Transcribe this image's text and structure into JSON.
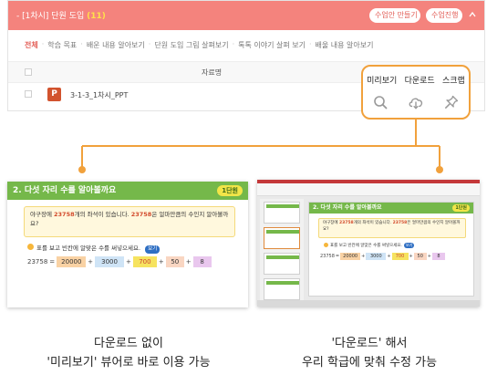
{
  "header": {
    "lesson": "- [1차시] 단원 도입",
    "count": "(11)",
    "btn_make": "수업안 만들기",
    "btn_progress": "수업진행"
  },
  "tabs": [
    "전체",
    "학습 목표",
    "배운 내용 알아보기",
    "단원 도입 그림 살펴보기",
    "톡톡 이야기 살펴 보기",
    "배울 내용 알아보기"
  ],
  "table": {
    "column_label": "자료명",
    "row_badge": "P",
    "row_file": "3-1-3_1차시_PPT"
  },
  "actions": {
    "preview": "미리보기",
    "download": "다운로드",
    "scrap": "스크랩",
    "colors": {
      "highlight": "#f1a13c",
      "header": "#f4837d"
    }
  },
  "slide": {
    "title": "2. 다섯 자리 수를 알아볼까요",
    "badge": "1단원",
    "question_a": "야구장에 ",
    "question_num1": "23758",
    "question_b": "개의 좌석이 있습니다. ",
    "question_num2": "23758",
    "question_c": "은 얼마만큼의 수인지 알아볼까요?",
    "prompt": "표를 보고 빈칸에 알맞은 수를 써넣으세요.",
    "pill": "보기",
    "eq_start": "23758",
    "eq_values": [
      "20000",
      "3000",
      "700",
      "50",
      "8"
    ]
  },
  "captions": {
    "left_line1": "다운로드 없이",
    "left_line2": "'미리보기' 뷰어로 바로 이용 가능",
    "right_line1": "'다운로드' 해서",
    "right_line2": "우리 학급에 맞춰 수정 가능"
  }
}
